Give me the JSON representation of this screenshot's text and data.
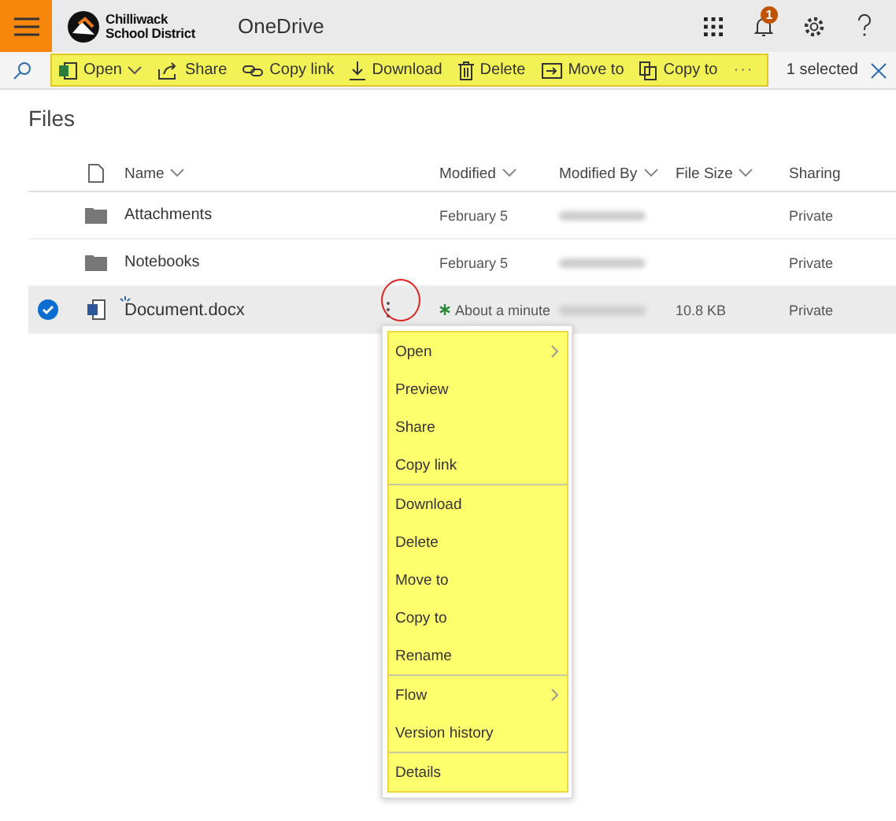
{
  "header": {
    "logo_line_1": "Chilliwack",
    "logo_line_2": "School District",
    "app_name": "OneDrive",
    "notification_count": "1"
  },
  "toolbar": {
    "commands": [
      {
        "label": "Open",
        "kind": "word",
        "has_dropdown": true
      },
      {
        "label": "Share",
        "kind": "share",
        "has_dropdown": false
      },
      {
        "label": "Copy link",
        "kind": "link",
        "has_dropdown": false
      },
      {
        "label": "Download",
        "kind": "download",
        "has_dropdown": false
      },
      {
        "label": "Delete",
        "kind": "delete",
        "has_dropdown": false
      },
      {
        "label": "Move to",
        "kind": "move",
        "has_dropdown": false
      },
      {
        "label": "Copy to",
        "kind": "copy",
        "has_dropdown": false
      }
    ],
    "more": "···",
    "selection": "1 selected"
  },
  "page_title": "Files",
  "table": {
    "columns": [
      {
        "label": "Name",
        "sortable": true
      },
      {
        "label": "Modified",
        "sortable": true
      },
      {
        "label": "Modified By",
        "sortable": true
      },
      {
        "label": "File Size",
        "sortable": true
      },
      {
        "label": "Sharing",
        "sortable": false
      }
    ],
    "rows": [
      {
        "kind": "folder",
        "name": "Attachments",
        "modified": "February 5",
        "recent": false,
        "size": "",
        "sharing": "Private",
        "selected": false
      },
      {
        "kind": "folder",
        "name": "Notebooks",
        "modified": "February 5",
        "recent": false,
        "size": "",
        "sharing": "Private",
        "selected": false
      },
      {
        "kind": "word",
        "name": "Document.docx",
        "modified": "About a minute",
        "recent": true,
        "size": "10.8 KB",
        "sharing": "Private",
        "selected": true
      }
    ]
  },
  "context_menu": {
    "groups": [
      [
        {
          "label": "Open",
          "submenu": true
        },
        {
          "label": "Preview",
          "submenu": false
        },
        {
          "label": "Share",
          "submenu": false
        },
        {
          "label": "Copy link",
          "submenu": false
        }
      ],
      [
        {
          "label": "Download",
          "submenu": false
        },
        {
          "label": "Delete",
          "submenu": false
        },
        {
          "label": "Move to",
          "submenu": false
        },
        {
          "label": "Copy to",
          "submenu": false
        },
        {
          "label": "Rename",
          "submenu": false
        }
      ],
      [
        {
          "label": "Flow",
          "submenu": true
        },
        {
          "label": "Version history",
          "submenu": false
        }
      ],
      [
        {
          "label": "Details",
          "submenu": false
        }
      ]
    ]
  }
}
